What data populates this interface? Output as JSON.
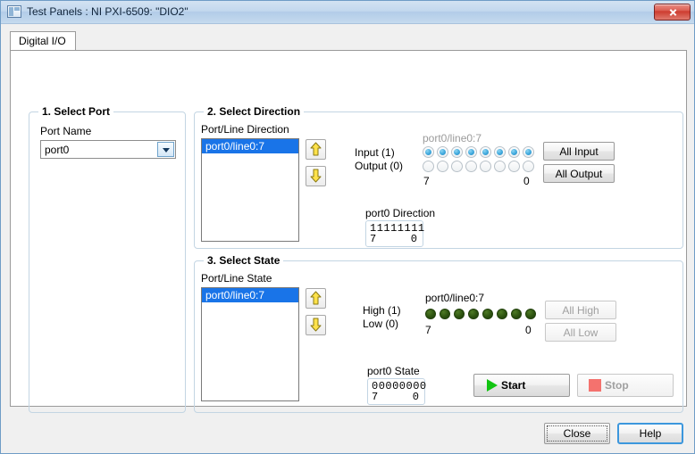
{
  "window": {
    "title": "Test Panels : NI PXI-6509: \"DIO2\"",
    "icon": "window-icon",
    "close_icon": "close-icon"
  },
  "tabs": [
    {
      "label": "Digital I/O",
      "selected": true
    }
  ],
  "select_port": {
    "group_title": "1. Select Port",
    "port_name_label": "Port Name",
    "port_name_value": "port0",
    "port_name_options": [
      "port0"
    ]
  },
  "select_direction": {
    "group_title": "2. Select Direction",
    "list_label": "Port/Line Direction",
    "list_items": [
      {
        "label": "port0/line0:7",
        "selected": true
      }
    ],
    "up_button": "move-up",
    "down_button": "move-down",
    "input_label": "Input (1)",
    "output_label": "Output (0)",
    "channel_label": "port0/line0:7",
    "bit_high_marker": "7",
    "bit_low_marker": "0",
    "input_states": [
      true,
      true,
      true,
      true,
      true,
      true,
      true,
      true
    ],
    "output_states": [
      false,
      false,
      false,
      false,
      false,
      false,
      false,
      false
    ],
    "all_input_label": "All Input",
    "all_output_label": "All Output",
    "value_label": "port0 Direction",
    "value": "11111111",
    "value_high_marker": "7",
    "value_low_marker": "0"
  },
  "select_state": {
    "group_title": "3. Select State",
    "list_label": "Port/Line State",
    "list_items": [
      {
        "label": "port0/line0:7",
        "selected": true
      }
    ],
    "up_button": "move-up",
    "down_button": "move-down",
    "high_label": "High (1)",
    "low_label": "Low (0)",
    "channel_label": "port0/line0:7",
    "bit_high_marker": "7",
    "bit_low_marker": "0",
    "led_states": [
      false,
      false,
      false,
      false,
      false,
      false,
      false,
      false
    ],
    "all_high_label": "All High",
    "all_low_label": "All Low",
    "value_label": "port0 State",
    "value": "00000000",
    "value_high_marker": "7",
    "value_low_marker": "0"
  },
  "run_controls": {
    "start_label": "Start",
    "stop_label": "Stop",
    "start_icon": "play-icon",
    "stop_icon": "stop-icon"
  },
  "dialog_buttons": {
    "close_label": "Close",
    "help_label": "Help"
  },
  "colors": {
    "selection_blue": "#1974e8",
    "led_off_green": "#2d5310",
    "indicator_blue": "#3fa9dd",
    "start_green": "#11c411",
    "stop_red": "#f4726e",
    "default_button_border": "#3c97dd"
  }
}
